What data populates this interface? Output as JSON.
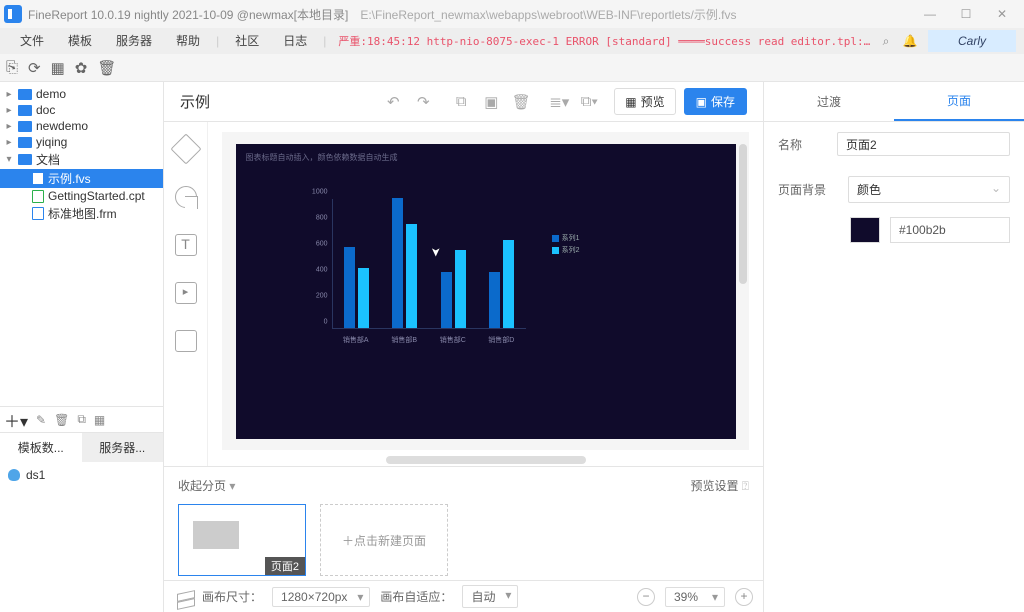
{
  "titlebar": {
    "title": "FineReport 10.0.19 nightly 2021-10-09 @newmax[本地目录]",
    "path": "E:\\FineReport_newmax\\webapps\\webroot\\WEB-INF\\reportlets/示例.fvs"
  },
  "menu": {
    "file": "文件",
    "template": "模板",
    "server": "服务器",
    "help": "帮助",
    "community": "社区",
    "log": "日志"
  },
  "logline": "严重:18:45:12 http-nio-8075-exec-1 ERROR [standard] ════success read editor.tpl: reportle...",
  "user": "Carly",
  "tree": {
    "items": [
      {
        "type": "folder",
        "name": "demo",
        "expand": true
      },
      {
        "type": "folder",
        "name": "doc",
        "expand": true
      },
      {
        "type": "folder",
        "name": "newdemo",
        "expand": true
      },
      {
        "type": "folder",
        "name": "yiqing",
        "expand": true
      },
      {
        "type": "folder",
        "name": "文档",
        "expand": false
      },
      {
        "type": "file",
        "name": "示例.fvs",
        "sel": true
      },
      {
        "type": "file",
        "name": "GettingStarted.cpt",
        "green": true
      },
      {
        "type": "file",
        "name": "标准地图.frm"
      }
    ]
  },
  "ds": {
    "tabs": {
      "a": "模板数...",
      "b": "服务器..."
    },
    "item": "ds1"
  },
  "doc": {
    "title": "示例",
    "preview": "预览",
    "save": "保存"
  },
  "pages": {
    "collapse": "收起分页",
    "settings": "预览设置",
    "thumb_tag": "页面2",
    "add": "点击新建页面"
  },
  "status": {
    "size_label": "画布尺寸：",
    "size": "1280×720px",
    "fit_label": "画布自适应：",
    "fit": "自动",
    "zoom": "39%"
  },
  "props": {
    "tabs": {
      "transition": "过渡",
      "page": "页面"
    },
    "name_label": "名称",
    "name_value": "页面2",
    "bg_label": "页面背景",
    "bg_type": "颜色",
    "bg_hex": "#100b2b"
  },
  "chart_data": {
    "type": "bar",
    "title": "图表标题自动插入，颜色依赖数据自动生成",
    "categories": [
      "销售部A",
      "销售部B",
      "销售部C",
      "销售部D"
    ],
    "series": [
      {
        "name": "系列1",
        "values": [
          620,
          1000,
          430,
          430
        ]
      },
      {
        "name": "系列2",
        "values": [
          460,
          800,
          600,
          680
        ]
      }
    ],
    "ylim": [
      0,
      1000
    ],
    "yticks": [
      0,
      200,
      400,
      600,
      800,
      1000
    ]
  }
}
